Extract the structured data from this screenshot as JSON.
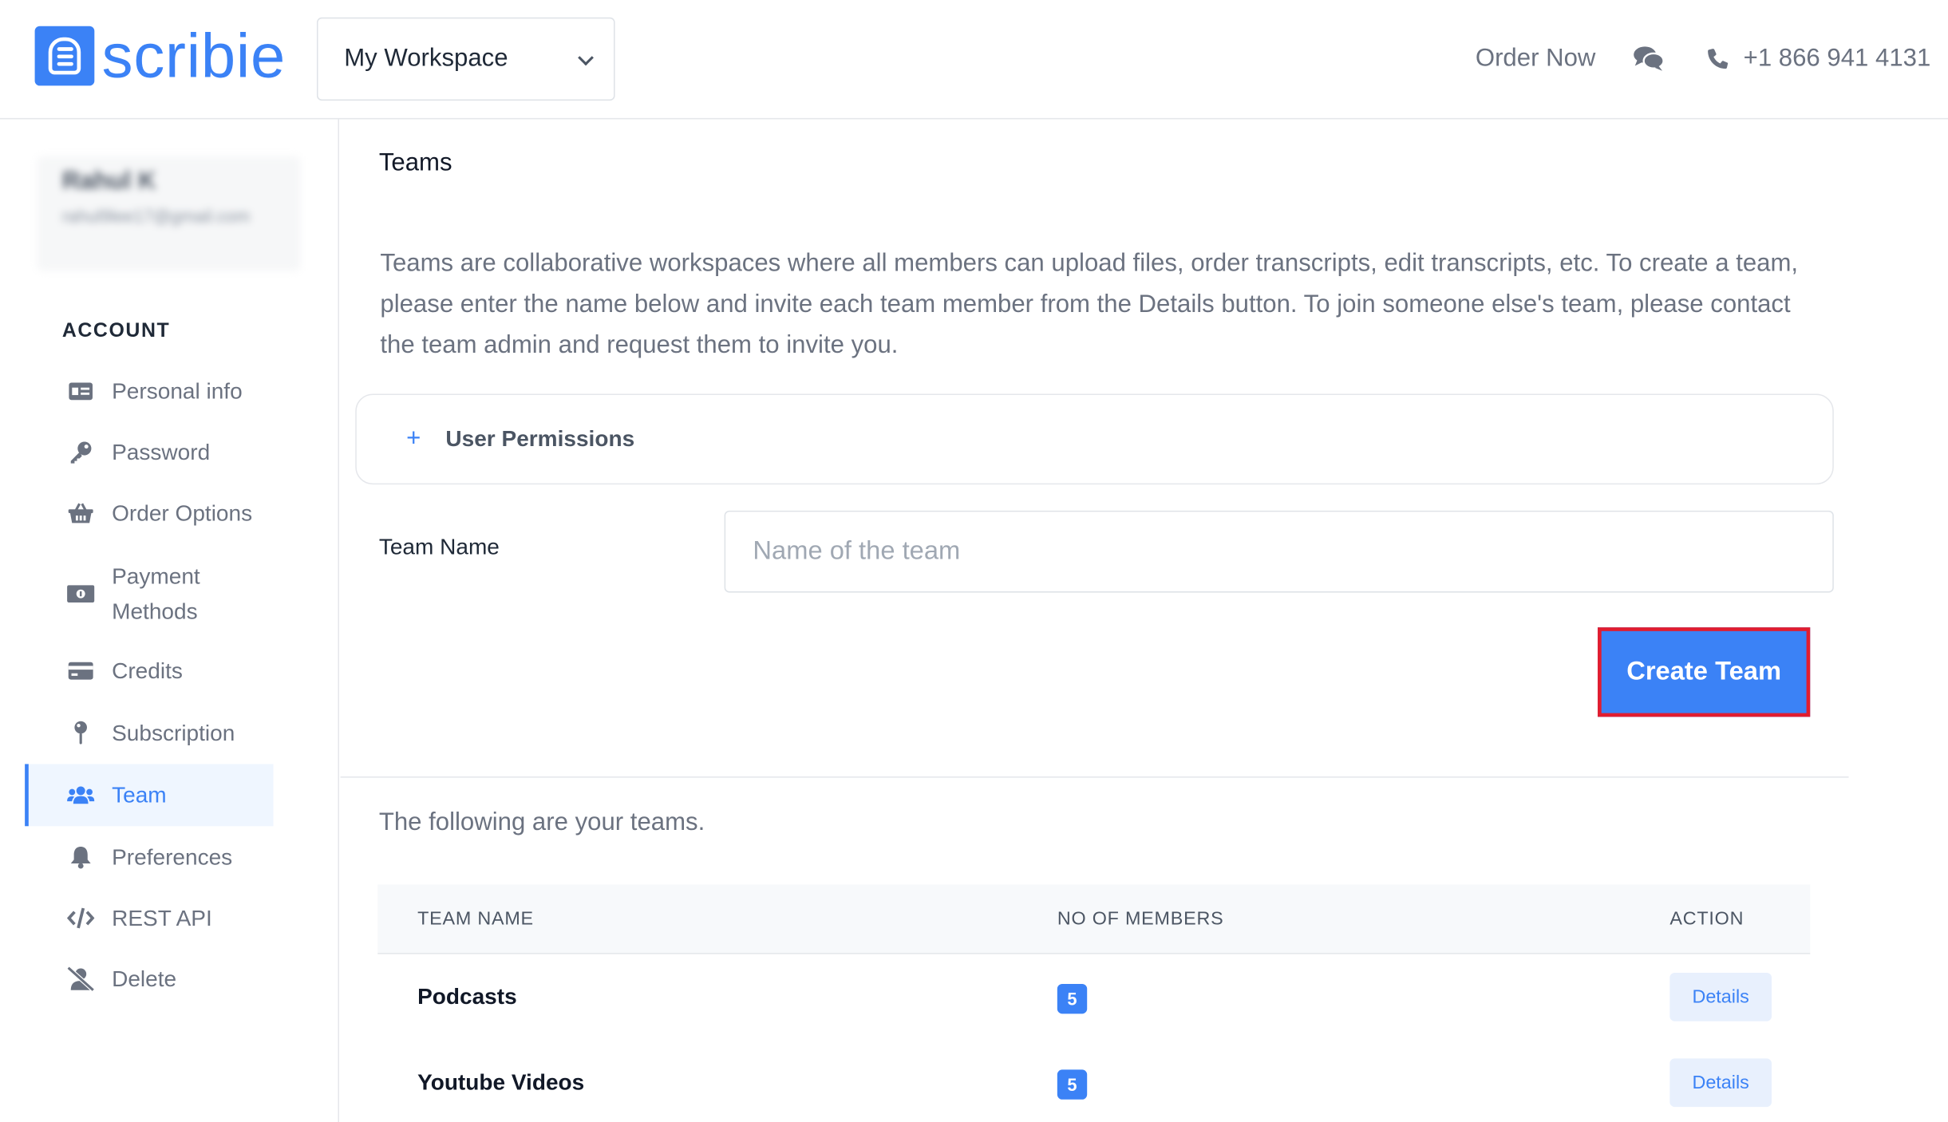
{
  "brand": {
    "name": "scribie",
    "color": "#3b82f6"
  },
  "header": {
    "workspace": "My Workspace",
    "order_now": "Order Now",
    "phone": "+1 866 941 4131"
  },
  "sidebar": {
    "user": {
      "name": "Rahul K",
      "email": "rahul9lee17@gmail.com"
    },
    "section_label": "ACCOUNT",
    "items": [
      {
        "label": "Personal info",
        "icon": "id-card-icon"
      },
      {
        "label": "Password",
        "icon": "key-icon"
      },
      {
        "label": "Order Options",
        "icon": "basket-icon"
      },
      {
        "label": "Payment Methods",
        "icon": "money-icon"
      },
      {
        "label": "Credits",
        "icon": "credit-card-icon"
      },
      {
        "label": "Subscription",
        "icon": "pin-icon"
      },
      {
        "label": "Team",
        "icon": "users-icon",
        "active": true
      },
      {
        "label": "Preferences",
        "icon": "bell-icon"
      },
      {
        "label": "REST API",
        "icon": "code-icon"
      },
      {
        "label": "Delete",
        "icon": "user-slash-icon"
      }
    ]
  },
  "main": {
    "title": "Teams",
    "intro": "Teams are collaborative workspaces where all members can upload files, order transcripts, edit transcripts, etc. To create a team, please enter the name below and invite each team member from the Details button. To join someone else's team, please contact the team admin and request them to invite you.",
    "permissions_label": "User Permissions",
    "team_name_label": "Team Name",
    "team_name_placeholder": "Name of the team",
    "team_name_value": "",
    "create_button": "Create Team",
    "teams_caption": "The following are your teams.",
    "table": {
      "headers": [
        "TEAM NAME",
        "NO OF MEMBERS",
        "ACTION"
      ],
      "rows": [
        {
          "name": "Podcasts",
          "members": "5",
          "action": "Details"
        },
        {
          "name": "Youtube Videos",
          "members": "5",
          "action": "Details"
        }
      ]
    }
  }
}
